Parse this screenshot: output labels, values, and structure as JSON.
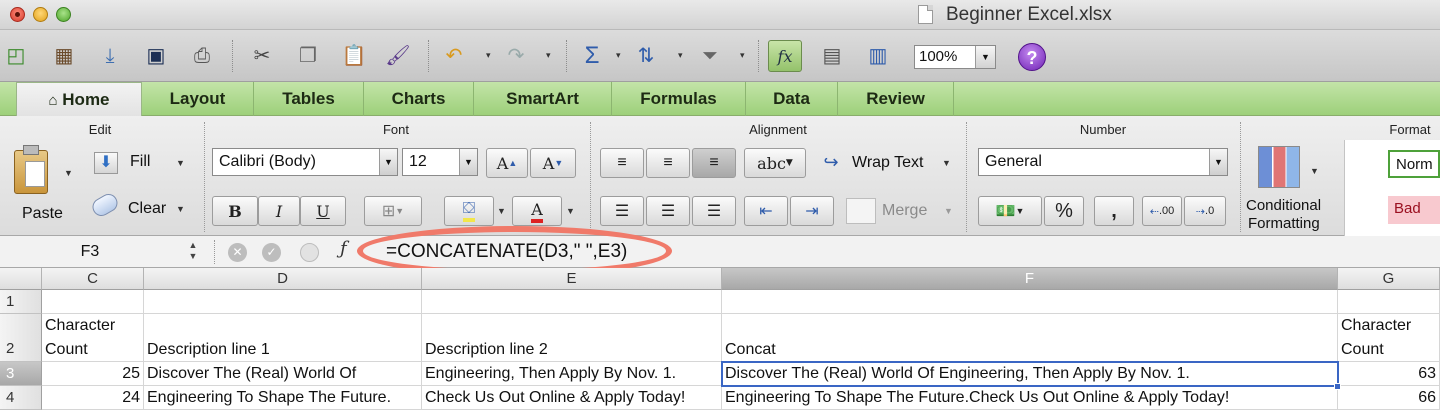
{
  "window": {
    "title": "Beginner Excel.xlsx",
    "buttons": [
      "close",
      "minimize",
      "zoom"
    ]
  },
  "toolbar": {
    "icons": [
      "new-icon",
      "templates-icon",
      "open-icon",
      "save-icon",
      "print-icon",
      "cut-icon",
      "copy-icon",
      "paste-icon",
      "format-painter-icon",
      "undo-icon",
      "redo-icon",
      "autosum-icon",
      "sort-icon",
      "filter-icon",
      "function-icon",
      "toolbox-icon",
      "media-icon"
    ],
    "zoom": "100%",
    "help": "?",
    "fx_label": "fx"
  },
  "ribbon_tabs": [
    "Home",
    "Layout",
    "Tables",
    "Charts",
    "SmartArt",
    "Formulas",
    "Data",
    "Review"
  ],
  "ribbon": {
    "edit": {
      "title": "Edit",
      "paste": "Paste",
      "fill": "Fill",
      "clear": "Clear"
    },
    "font": {
      "title": "Font",
      "family": "Calibri (Body)",
      "size": "12",
      "bold": "B",
      "italic": "I",
      "underline": "U",
      "grow": "A",
      "shrink": "A",
      "color": "A"
    },
    "alignment": {
      "title": "Alignment",
      "abc": "abc",
      "wrap_text": "Wrap Text",
      "merge": "Merge"
    },
    "number": {
      "title": "Number",
      "format": "General",
      "percent": "%",
      "comma": ",",
      "inc_decimal": ".00",
      "dec_decimal": ".0"
    },
    "format": {
      "title": "Format",
      "conditional_1": "Conditional",
      "conditional_2": "Formatting",
      "style_normal": "Norm",
      "style_bad": "Bad"
    }
  },
  "formula_bar": {
    "name_box": "F3",
    "formula": "=CONCATENATE(D3,\" \",E3)"
  },
  "sheet": {
    "columns": [
      "C",
      "D",
      "E",
      "F",
      "G"
    ],
    "rows": [
      "1",
      "2",
      "3",
      "4"
    ],
    "r2": {
      "c1": "Character",
      "c2": "Count",
      "d": "Description line 1",
      "e": "Description line 2",
      "f": "Concat",
      "g1": "Character",
      "g2": "Count"
    },
    "r3": {
      "c": "25",
      "d": "Discover The (Real) World Of",
      "e": "Engineering, Then Apply By Nov. 1.",
      "f": "Discover The (Real) World Of Engineering, Then Apply By Nov. 1.",
      "g": "63"
    },
    "r4": {
      "c": "24",
      "d": "Engineering To Shape The Future.",
      "e": "Check Us Out Online & Apply Today!",
      "f": "Engineering To Shape The Future.Check Us Out Online & Apply Today!",
      "g": "66"
    },
    "selected_cell": "F3"
  },
  "colors": {
    "ribbon_tab_green": "#9dd07a",
    "selection_blue": "#3a66c4",
    "annotation_red": "#f07a6a"
  }
}
